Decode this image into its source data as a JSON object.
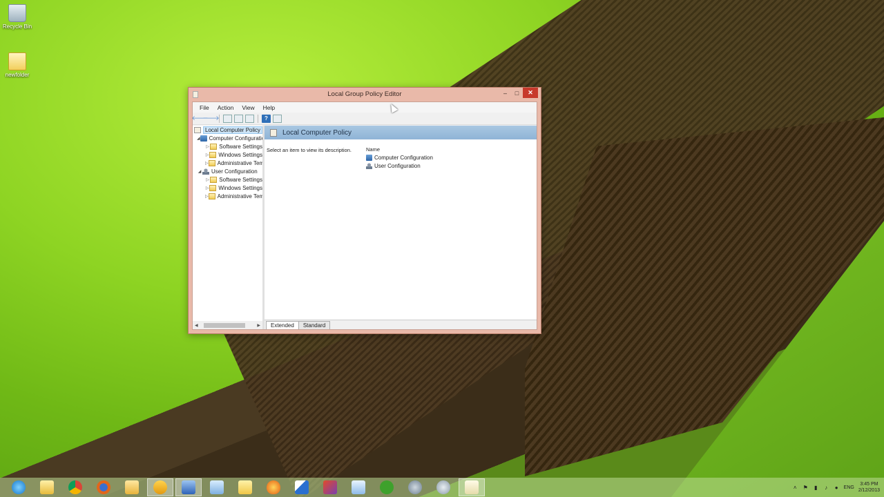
{
  "desktop": {
    "icons": [
      {
        "label": "Recycle Bin",
        "icon": "recycle-bin-icon"
      },
      {
        "label": "newfolder",
        "icon": "folder-icon"
      }
    ]
  },
  "window": {
    "title": "Local Group Policy Editor",
    "minimize": "–",
    "maximize": "□",
    "close": "✕",
    "menu": [
      "File",
      "Action",
      "View",
      "Help"
    ],
    "toolbar": {
      "back": "🡐",
      "forward": "🡒",
      "help": "?"
    },
    "tree": {
      "root": "Local Computer Policy",
      "computer": {
        "label": "Computer Configuration",
        "children": [
          "Software Settings",
          "Windows Settings",
          "Administrative Templates"
        ]
      },
      "user": {
        "label": "User Configuration",
        "children": [
          "Software Settings",
          "Windows Settings",
          "Administrative Templates"
        ]
      }
    },
    "detail": {
      "header": "Local Computer Policy",
      "description": "Select an item to view its description.",
      "column_name": "Name",
      "items": [
        "Computer Configuration",
        "User Configuration"
      ]
    },
    "tabs": [
      "Extended",
      "Standard"
    ]
  },
  "taskbar": {
    "apps": [
      "internet-explorer-icon",
      "file-explorer-icon",
      "chrome-icon",
      "firefox-icon",
      "mail-icon",
      "remote-icon",
      "network-icon",
      "document-icon",
      "folder-icon",
      "fire-icon",
      "paint-icon",
      "office-icon",
      "notepad-icon",
      "spotify-icon",
      "tool-icon",
      "settings-icon",
      "policy-editor-icon"
    ],
    "language": "ENG",
    "time": "3:45 PM",
    "date": "2/12/2013"
  }
}
